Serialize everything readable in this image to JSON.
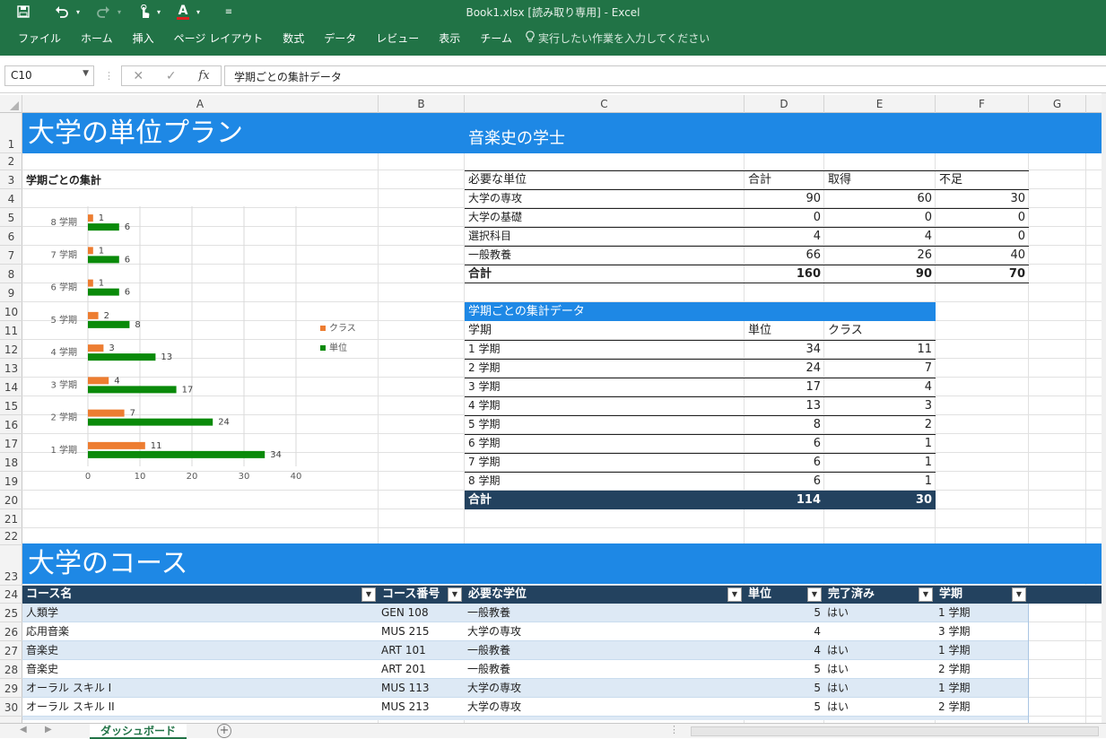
{
  "window": {
    "title": "Book1.xlsx [読み取り専用] - Excel"
  },
  "ribbon": {
    "tabs": [
      "ファイル",
      "ホーム",
      "挿入",
      "ページ レイアウト",
      "数式",
      "データ",
      "レビュー",
      "表示",
      "チーム"
    ],
    "tell_me": "実行したい作業を入力してください",
    "font_color_label": "A"
  },
  "formula_bar": {
    "name_box": "C10",
    "fx_label": "fx",
    "formula": "学期ごとの集計データ"
  },
  "columns": [
    "A",
    "B",
    "C",
    "D",
    "E",
    "F",
    "G"
  ],
  "rows": [
    "1",
    "2",
    "3",
    "4",
    "5",
    "6",
    "7",
    "8",
    "9",
    "10",
    "11",
    "12",
    "13",
    "14",
    "15",
    "16",
    "17",
    "18",
    "19",
    "20",
    "21",
    "22",
    "23",
    "24",
    "25",
    "26",
    "27",
    "28",
    "29",
    "30"
  ],
  "header": {
    "title": "大学の単位プラン",
    "degree": "音楽史の学士",
    "section_title": "大学のコース"
  },
  "summary": {
    "chart_label": "学期ごとの集計",
    "headers": [
      "必要な単位",
      "合計",
      "取得",
      "不足"
    ],
    "rows": [
      {
        "name": "大学の専攻",
        "total": "90",
        "earned": "60",
        "short": "30"
      },
      {
        "name": "大学の基礎",
        "total": "0",
        "earned": "0",
        "short": "0"
      },
      {
        "name": "選択科目",
        "total": "4",
        "earned": "4",
        "short": "0"
      },
      {
        "name": "一般教養",
        "total": "66",
        "earned": "26",
        "short": "40"
      }
    ],
    "total_row": {
      "name": "合計",
      "total": "160",
      "earned": "90",
      "short": "70"
    }
  },
  "semester_table": {
    "title": "学期ごとの集計データ",
    "headers": [
      "学期",
      "単位",
      "クラス"
    ],
    "rows": [
      {
        "term": "1 学期",
        "credits": "34",
        "classes": "11"
      },
      {
        "term": "2 学期",
        "credits": "24",
        "classes": "7"
      },
      {
        "term": "3 学期",
        "credits": "17",
        "classes": "4"
      },
      {
        "term": "4 学期",
        "credits": "13",
        "classes": "3"
      },
      {
        "term": "5 学期",
        "credits": "8",
        "classes": "2"
      },
      {
        "term": "6 学期",
        "credits": "6",
        "classes": "1"
      },
      {
        "term": "7 学期",
        "credits": "6",
        "classes": "1"
      },
      {
        "term": "8 学期",
        "credits": "6",
        "classes": "1"
      }
    ],
    "total": {
      "label": "合計",
      "credits": "114",
      "classes": "30"
    }
  },
  "courses": {
    "headers": [
      "コース名",
      "コース番号",
      "必要な学位",
      "単位",
      "完了済み",
      "学期"
    ],
    "rows": [
      {
        "name": "人類学",
        "code": "GEN 108",
        "req": "一般教養",
        "credits": "5",
        "done": "はい",
        "term": "1 学期"
      },
      {
        "name": "応用音楽",
        "code": "MUS 215",
        "req": "大学の専攻",
        "credits": "4",
        "done": "",
        "term": "3 学期"
      },
      {
        "name": "音楽史",
        "code": "ART 101",
        "req": "一般教養",
        "credits": "4",
        "done": "はい",
        "term": "1 学期"
      },
      {
        "name": "音楽史",
        "code": "ART 201",
        "req": "一般教養",
        "credits": "5",
        "done": "はい",
        "term": "2 学期"
      },
      {
        "name": "オーラル スキル I",
        "code": "MUS 113",
        "req": "大学の専攻",
        "credits": "5",
        "done": "はい",
        "term": "1 学期"
      },
      {
        "name": "オーラル スキル II",
        "code": "MUS 213",
        "req": "大学の専攻",
        "credits": "5",
        "done": "はい",
        "term": "2 学期"
      }
    ]
  },
  "sheet_tab": "ダッシュボード",
  "colors": {
    "ribbon": "#217346",
    "band": "#1e88e5",
    "dark": "#23425f",
    "stripe": "#dde9f5",
    "orange": "#ed7d31",
    "green": "#0a8a0a"
  },
  "chart_data": {
    "type": "bar",
    "orientation": "horizontal",
    "categories": [
      "1 学期",
      "2 学期",
      "3 学期",
      "4 学期",
      "5 学期",
      "6 学期",
      "7 学期",
      "8 学期"
    ],
    "series": [
      {
        "name": "単位",
        "values": [
          34,
          24,
          17,
          13,
          8,
          6,
          6,
          6
        ]
      },
      {
        "name": "クラス",
        "values": [
          11,
          7,
          4,
          3,
          2,
          1,
          1,
          1
        ]
      }
    ],
    "xlim": [
      0,
      40
    ],
    "xticks": [
      "0",
      "10",
      "20",
      "30",
      "40"
    ],
    "legend_position": "right",
    "grid": true
  }
}
